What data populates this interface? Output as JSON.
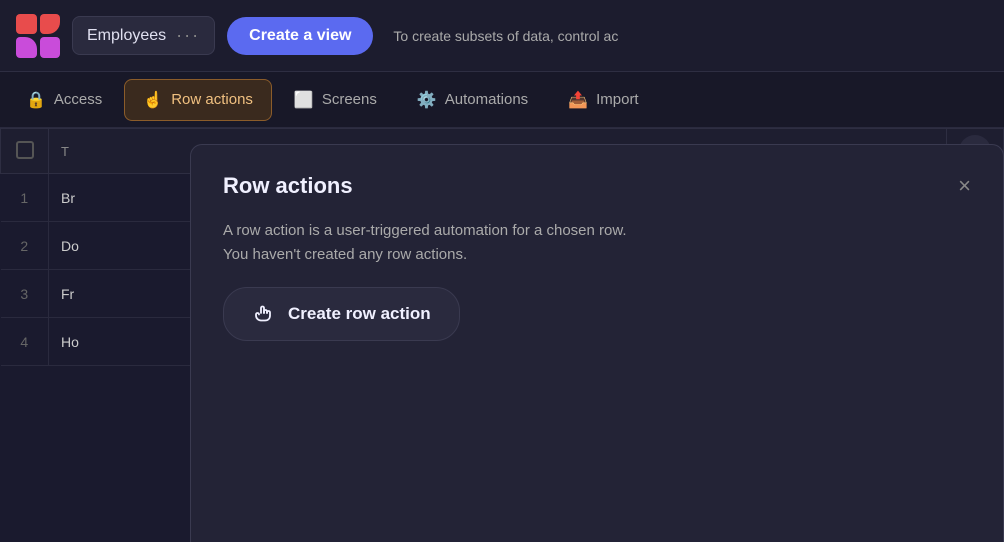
{
  "topBar": {
    "appTitle": "Employees",
    "dotsLabel": "···",
    "createViewLabel": "Create a view",
    "descriptionText": "To create subsets of data, control ac"
  },
  "navTabs": [
    {
      "id": "access",
      "label": "Access",
      "icon": "lock",
      "active": false
    },
    {
      "id": "row-actions",
      "label": "Row actions",
      "icon": "hand",
      "active": true
    },
    {
      "id": "screens",
      "label": "Screens",
      "icon": "screen",
      "active": false
    },
    {
      "id": "automations",
      "label": "Automations",
      "icon": "node",
      "active": false
    },
    {
      "id": "import",
      "label": "Import",
      "icon": "import",
      "active": false
    }
  ],
  "table": {
    "rows": [
      {
        "num": "1",
        "name": "Br"
      },
      {
        "num": "2",
        "name": "Do"
      },
      {
        "num": "3",
        "name": "Fr"
      },
      {
        "num": "4",
        "name": "Ho"
      }
    ]
  },
  "modal": {
    "title": "Row actions",
    "closeLabel": "×",
    "description": "A row action is a user-triggered automation for a chosen row.\nYou haven't created any row actions.",
    "createButtonLabel": "Create row action"
  }
}
